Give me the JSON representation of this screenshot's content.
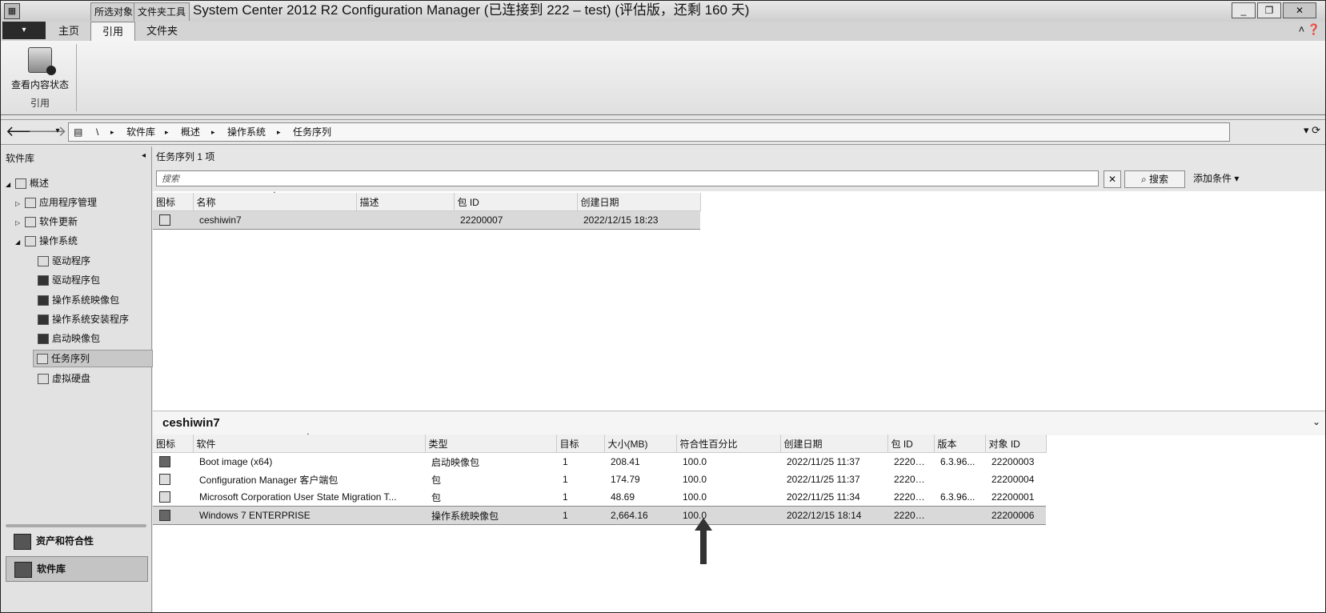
{
  "titlebar": {
    "ctx_tab_1": "所选对象",
    "ctx_tab_2": "文件夹工具",
    "title": "System Center 2012 R2 Configuration Manager (已连接到 222 – test) (评估版，还剩 160 天)",
    "minimize": "_",
    "restore": "❐",
    "close": "✕"
  },
  "ribbon": {
    "file_label": "▾",
    "tabs": [
      "主页",
      "引用",
      "文件夹"
    ],
    "active_tab": "引用",
    "right_controls": "˄ ❓",
    "button_label": "查看内容状态",
    "group_label": "引用"
  },
  "address": {
    "back": "🡐",
    "forward": "🡒",
    "dropdown": "▾",
    "crumbs": [
      "\\",
      "▸",
      "软件库",
      "▸",
      "概述",
      "▸",
      "操作系统",
      "▸",
      "任务序列"
    ],
    "right": "▾ ⟳"
  },
  "nav": {
    "title": "软件库",
    "collapse": "◂",
    "items": [
      {
        "label": "概述",
        "arrow": "◢"
      },
      {
        "label": "应用程序管理",
        "arrow": "▷"
      },
      {
        "label": "软件更新",
        "arrow": "▷"
      },
      {
        "label": "操作系统",
        "arrow": "◢"
      },
      {
        "label": "驱动程序"
      },
      {
        "label": "驱动程序包"
      },
      {
        "label": "操作系统映像包"
      },
      {
        "label": "操作系统安装程序"
      },
      {
        "label": "启动映像包"
      },
      {
        "label": "任务序列"
      },
      {
        "label": "虚拟硬盘"
      }
    ],
    "workspaces": [
      "资产和符合性",
      "软件库"
    ]
  },
  "list": {
    "header": "任务序列 1 项",
    "search_placeholder": "搜索",
    "clear": "✕",
    "search_button": "⌕ 搜索",
    "add_criteria": "添加条件 ▾",
    "columns": [
      "图标",
      "名称",
      "描述",
      "包 ID",
      "创建日期"
    ],
    "rows": [
      {
        "name": "ceshiwin7",
        "desc": "",
        "pkg_id": "22200007",
        "created": "2022/12/15 18:23"
      }
    ]
  },
  "detail": {
    "title": "ceshiwin7",
    "chevron": "⌄",
    "columns": [
      "图标",
      "软件",
      "类型",
      "目标",
      "大小(MB)",
      "符合性百分比",
      "创建日期",
      "包 ID",
      "版本",
      "对象 ID"
    ],
    "rows": [
      {
        "software": "Boot image (x64)",
        "type": "启动映像包",
        "target": "1",
        "size": "208.41",
        "pct": "100.0",
        "created": "2022/11/25 11:37",
        "pkg": "22200...",
        "version": "6.3.96...",
        "obj": "22200003"
      },
      {
        "software": "Configuration Manager 客户端包",
        "type": "包",
        "target": "1",
        "size": "174.79",
        "pct": "100.0",
        "created": "2022/11/25 11:37",
        "pkg": "22200...",
        "version": "",
        "obj": "22200004"
      },
      {
        "software": "Microsoft Corporation User State Migration T...",
        "type": "包",
        "target": "1",
        "size": "48.69",
        "pct": "100.0",
        "created": "2022/11/25 11:34",
        "pkg": "22200...",
        "version": "6.3.96...",
        "obj": "22200001"
      },
      {
        "software": "Windows 7 ENTERPRISE",
        "type": "操作系统映像包",
        "target": "1",
        "size": "2,664.16",
        "pct": "100.0",
        "created": "2022/12/15 18:14",
        "pkg": "22200...",
        "version": "",
        "obj": "22200006"
      }
    ]
  }
}
